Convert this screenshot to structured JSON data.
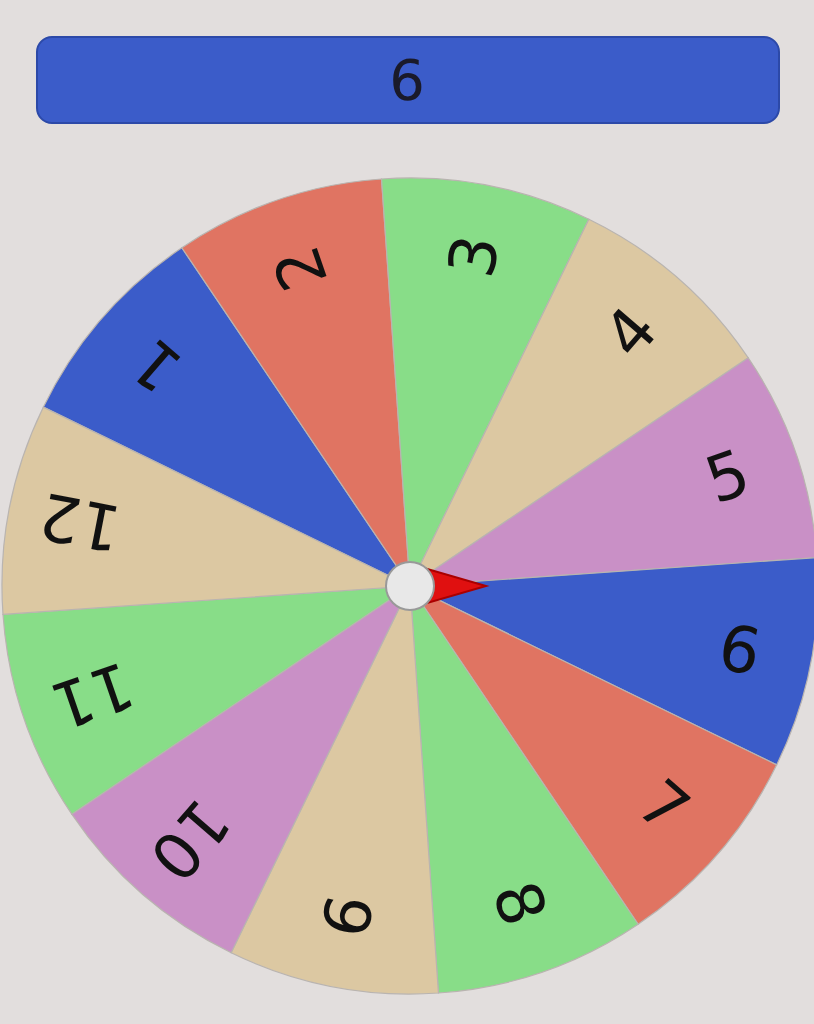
{
  "result": "6",
  "wheel": {
    "segments": [
      {
        "label": "1",
        "color": "#3b5cc9"
      },
      {
        "label": "2",
        "color": "#e07462"
      },
      {
        "label": "3",
        "color": "#88dd88"
      },
      {
        "label": "4",
        "color": "#dcc8a2"
      },
      {
        "label": "5",
        "color": "#c990c6"
      },
      {
        "label": "6",
        "color": "#3b5cc9"
      },
      {
        "label": "7",
        "color": "#e07462"
      },
      {
        "label": "8",
        "color": "#88dd88"
      },
      {
        "label": "9",
        "color": "#dcc8a2"
      },
      {
        "label": "10",
        "color": "#c990c6"
      },
      {
        "label": "11",
        "color": "#88dd88"
      },
      {
        "label": "12",
        "color": "#dcc8a2"
      }
    ]
  }
}
